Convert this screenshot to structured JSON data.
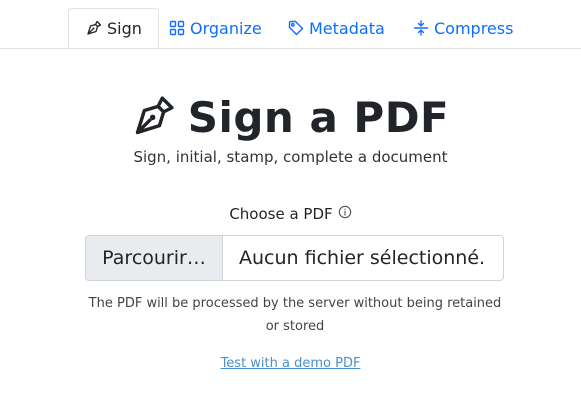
{
  "tabs": {
    "sign": "Sign",
    "organize": "Organize",
    "metadata": "Metadata",
    "compress": "Compress"
  },
  "page": {
    "title": "Sign a PDF",
    "subtitle": "Sign, initial, stamp, complete a document"
  },
  "form": {
    "choose_label": "Choose a PDF",
    "browse_button": "Parcourir…",
    "file_status": "Aucun fichier sélectionné.",
    "help_text": "The PDF will be processed by the server without being retained or stored",
    "demo_link": "Test with a demo PDF"
  },
  "colors": {
    "link": "#0d6efd",
    "text": "#212529"
  },
  "icons": {
    "sign": "pen-nib-icon",
    "organize": "grid-icon",
    "metadata": "tag-icon",
    "compress": "compress-arrows-icon",
    "info": "info-circle-icon"
  }
}
